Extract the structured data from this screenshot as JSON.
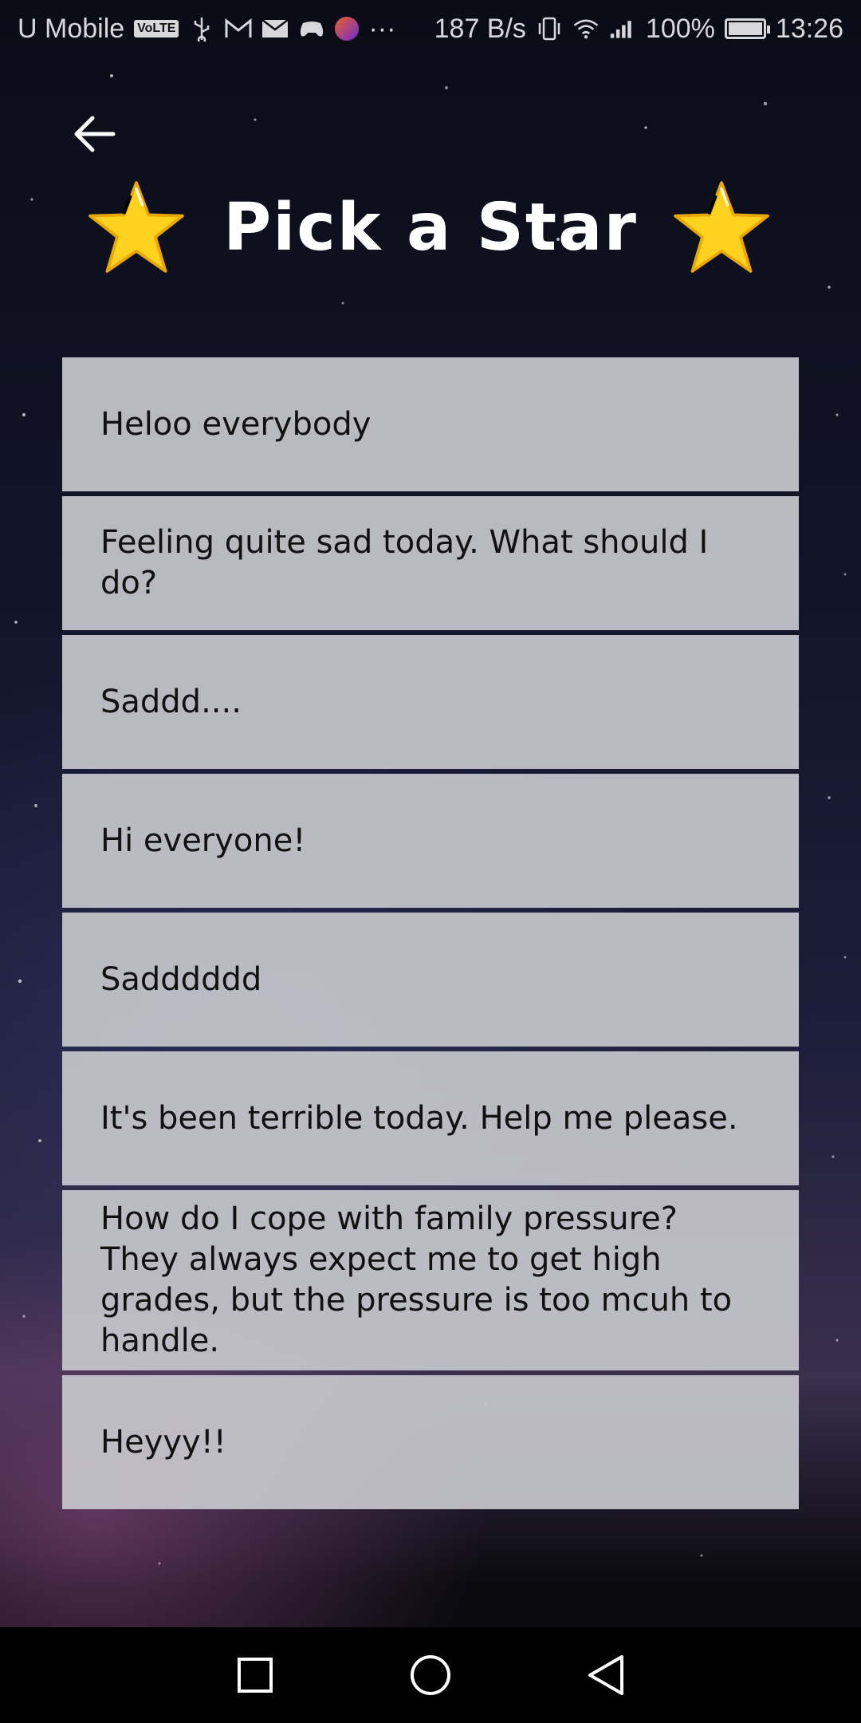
{
  "status_bar": {
    "carrier": "U Mobile",
    "volte_badge": "VoLTE",
    "more": "···",
    "net_speed": "187 B/s",
    "battery": "100%",
    "battery_level": 1.0,
    "time": "13:26"
  },
  "header": {
    "title": "Pick a Star",
    "back_icon": "arrow-left-icon",
    "star_icon": "star-icon",
    "star_color": "#FFD21F"
  },
  "posts": [
    {
      "text": "Heloo everybody"
    },
    {
      "text": "Feeling quite sad today. What should I do?"
    },
    {
      "text": "Saddd...."
    },
    {
      "text": "Hi everyone!"
    },
    {
      "text": "Sadddddd"
    },
    {
      "text": "It's been terrible today. Help me please."
    },
    {
      "text": "How do I cope with family pressure? They always expect me to get high grades, but the pressure is too mcuh to handle."
    },
    {
      "text": "Heyyy!!"
    }
  ],
  "nav": {
    "recents_icon": "square-icon",
    "home_icon": "circle-icon",
    "back_icon": "triangle-back-icon"
  }
}
